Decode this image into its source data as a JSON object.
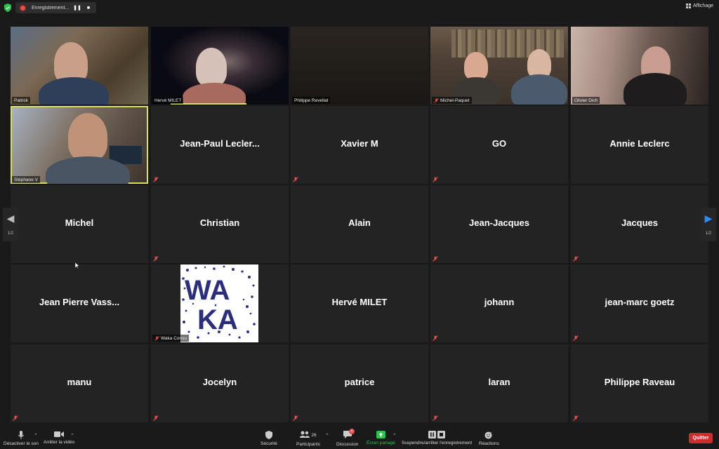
{
  "topbar": {
    "recording_label": "Enregistrement...",
    "view_label": "Affichage"
  },
  "video_tiles": [
    {
      "name": "Patrick",
      "muted": false
    },
    {
      "name": "Hervé MILET",
      "muted": false
    },
    {
      "name": "Philippe Revellat",
      "muted": false
    },
    {
      "name": "Michel-Paquet",
      "muted": true
    },
    {
      "name": "Olivier Dich",
      "muted": false
    },
    {
      "name": "Stéphane V",
      "muted": false
    }
  ],
  "name_tiles": [
    "Jean-Paul  Lecler...",
    "Xavier M",
    "GO",
    "Annie Leclerc",
    "Michel",
    "Christian",
    "Alain",
    "Jean-Jacques",
    "Jacques",
    "Jean  Pierre  Vass...",
    "Hervé MILET",
    "johann",
    "jean-marc goetz",
    "manu",
    "Jocelyn",
    "patrice",
    "laran",
    "Philippe Raveau"
  ],
  "logo_tile": {
    "name": "Waka Consu",
    "logo_line1": "WA",
    "logo_line2": "KA"
  },
  "pagination": {
    "left": "1/2",
    "right": "1/2"
  },
  "toolbar": {
    "mute": "Désactiver le son",
    "video": "Arrêter la vidéo",
    "security": "Sécurité",
    "participants": "Participants",
    "participants_count": "26",
    "chat": "Discussion",
    "chat_badge": "4",
    "share": "Écran partagé",
    "record": "Suspendre/arrêter l'enregistrement",
    "reactions": "Réactions",
    "quit": "Quitter"
  },
  "colors": {
    "speaker_outline": "#d7e05a",
    "share_green": "#2dc44e",
    "quit_red": "#cc2d2d",
    "mute_red": "#e8504e",
    "nav_blue": "#2d8cff"
  }
}
